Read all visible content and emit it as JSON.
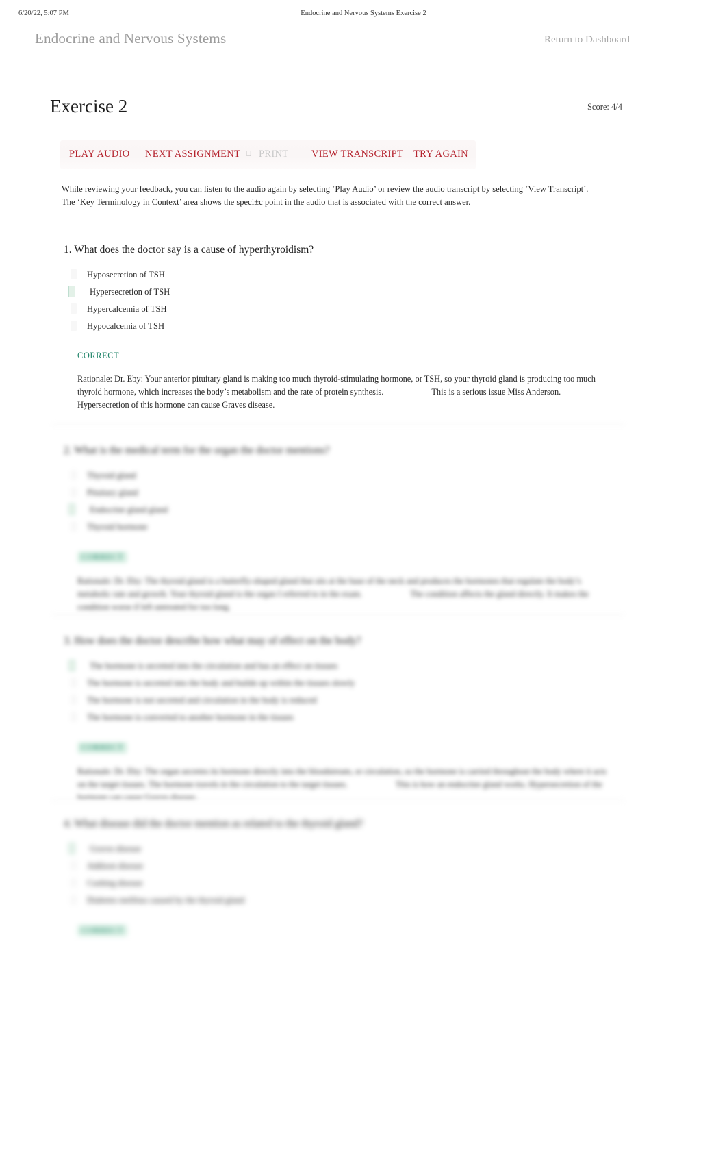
{
  "print_header": {
    "timestamp": "6/20/22, 5:07 PM",
    "document_title": "Endocrine and Nervous Systems Exercise 2"
  },
  "topbar": {
    "brand": "Endocrine and Nervous Systems",
    "return_link": "Return to Dashboard"
  },
  "header": {
    "title": "Exercise 2",
    "score_label": "Score: 4/4"
  },
  "toolbar": {
    "play_audio": "PLAY AUDIO",
    "next_assignment": "NEXT ASSIGNMENT",
    "separator_glyph": "⎕",
    "print": "PRINT",
    "view_transcript": "VIEW TRANSCRIPT",
    "try_again": "TRY AGAIN"
  },
  "instructions": {
    "line1": "While reviewing your feedback, you can listen to the audio again by selecting ‘Play Audio’ or review the audio transcript by selecting ‘View Transcript’.",
    "line2": "The ‘Key Terminology in Context’ area shows the speci±c point in the audio that is associated with the correct answer."
  },
  "questions": [
    {
      "number": "1.",
      "text": "1. What does the doctor say is a cause of hyperthyroidism?",
      "options": [
        "Hyposecretion of TSH",
        "Hypersecretion of TSH",
        "Hypercalcemia of TSH",
        "Hypocalcemia of TSH"
      ],
      "selected_index": 1,
      "verdict": "CORRECT",
      "rationale_line1": "Rationale: Dr. Eby:  Your anterior pituitary gland is making too much thyroid-stimulating hormone, or TSH, so your thyroid gland is producing",
      "rationale_line2a": "too much thyroid hormone, which increases the body’s metabolism and the rate of protein synthesis.",
      "rationale_line2b": "This is a serious issue Miss Anderson.",
      "rationale_line3": "Hypersecretion of this hormone can cause Graves disease."
    },
    {
      "number": "2.",
      "text": "2. What is the medical term for the organ the doctor mentions?",
      "options": [
        "Thyroid gland",
        "Pituitary gland",
        "Endocrine gland gland",
        "Thyroid hormone"
      ],
      "selected_index": 2,
      "verdict": "CORRECT",
      "rationale_line1": "Rationale: Dr. Eby: The thyroid gland is a butterfly-shaped gland that sits at the base of the neck and produces the hormones that regulate",
      "rationale_line2a": "the body’s metabolic rate and growth. Your thyroid gland is the organ I referred to in the exam.",
      "rationale_line2b": "The condition affects the gland directly.",
      "rationale_line3": "It makes the condition worse if left untreated for too long."
    },
    {
      "number": "3.",
      "text": "3. How does the doctor describe how what may of effect on the body?",
      "options": [
        "The hormone is secreted into the circulation and has an effect on tissues",
        "The hormone is secreted into the body and builds up within the tissues slowly",
        "The hormone is not secreted and circulation in the body is reduced",
        "The hormone is converted to another hormone in the tissues"
      ],
      "selected_index": 0,
      "verdict": "CORRECT",
      "rationale_line1": "Rationale: Dr. Eby: The organ secretes its hormone directly into the bloodstream, or circulation, so the hormone is carried throughout",
      "rationale_line2a": "the body where it acts on the target tissues. The hormone travels in the circulation to the target tissues.",
      "rationale_line2b": "This is how an endocrine gland works.",
      "rationale_line3": "Hypersecretion of the hormone can cause Graves disease."
    },
    {
      "number": "4.",
      "text": "4. What disease did the doctor mention as related to the thyroid gland?",
      "options": [
        "Graves disease",
        "Addison disease",
        "Cushing disease",
        "Diabetes mellitus caused by the thyroid gland"
      ],
      "selected_index": 0,
      "verdict": "CORRECT",
      "rationale_line1": "",
      "rationale_line2a": "",
      "rationale_line2b": "",
      "rationale_line3": ""
    }
  ]
}
